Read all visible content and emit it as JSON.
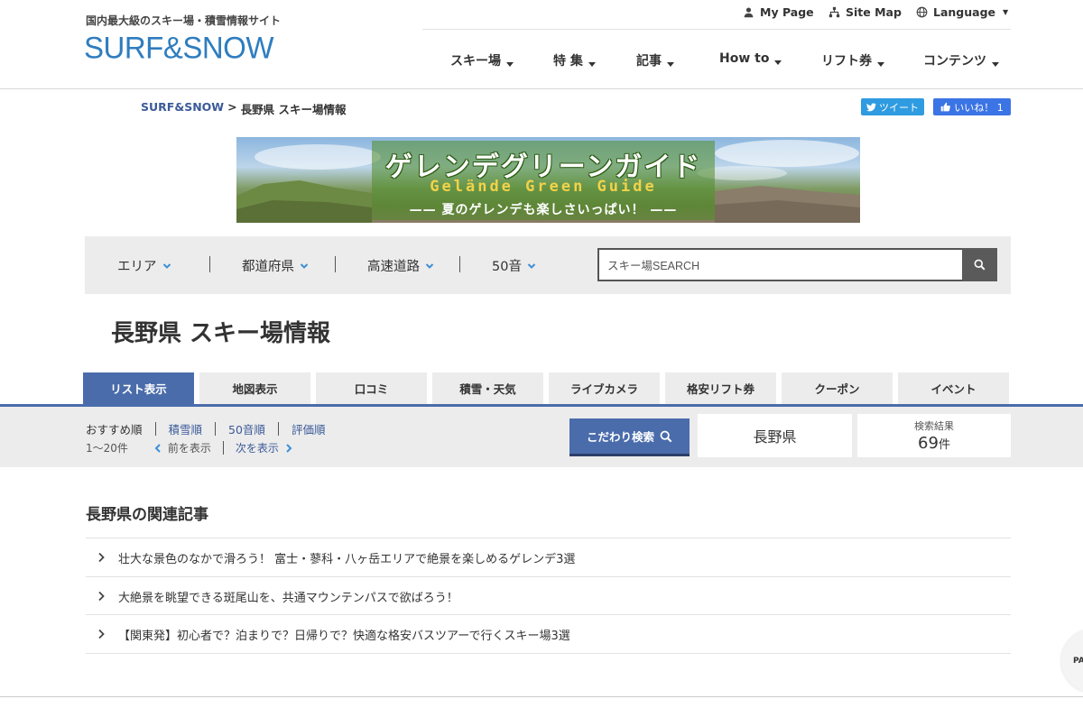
{
  "header": {
    "tagline": "国内最大級のスキー場・積雪情報サイト",
    "logo": "SURF&SNOW",
    "utility": {
      "my_page": "My Page",
      "site_map": "Site Map",
      "language": "Language"
    },
    "nav": [
      {
        "label": "スキー場"
      },
      {
        "label": "特 集"
      },
      {
        "label": "記事"
      },
      {
        "label": "How to"
      },
      {
        "label": "リフト券"
      },
      {
        "label": "コンテンツ"
      }
    ]
  },
  "breadcrumb": {
    "home": "SURF&SNOW",
    "separator": ">",
    "current": "長野県 スキー場情報"
  },
  "social": {
    "tweet": "ツイート",
    "like": "いいね！ 1"
  },
  "banner": {
    "title": "ゲレンデグリーンガイド",
    "subtitle": "Gelände Green Guide",
    "tagline": "—— 夏のゲレンデも楽しさいっぱい！ ——"
  },
  "filters": [
    {
      "label": "エリア"
    },
    {
      "label": "都道府県"
    },
    {
      "label": "高速道路"
    },
    {
      "label": "50音"
    }
  ],
  "search": {
    "placeholder": "スキー場SEARCH"
  },
  "page_title": "長野県 スキー場情報",
  "tabs": [
    {
      "label": "リスト表示",
      "active": true
    },
    {
      "label": "地図表示"
    },
    {
      "label": "口コミ"
    },
    {
      "label": "積雪・天気"
    },
    {
      "label": "ライブカメラ"
    },
    {
      "label": "格安リフト券"
    },
    {
      "label": "クーポン"
    },
    {
      "label": "イベント"
    }
  ],
  "sort": {
    "options": [
      "おすすめ順",
      "積雪順",
      "50音順",
      "評価順"
    ],
    "range": "1〜20件",
    "prev": "前を表示",
    "next": "次を表示"
  },
  "kodawari_search": "こだわり検索",
  "prefecture": "長野県",
  "result": {
    "label": "検索結果",
    "count": "69",
    "unit": "件"
  },
  "related": {
    "title": "長野県の関連記事",
    "articles": [
      "壮大な景色のなかで滑ろう！ 富士・蓼科・八ヶ岳エリアで絶景を楽しめるゲレンデ3選",
      "大絶景を眺望できる斑尾山を、共通マウンテンパスで欲ばろう！",
      "【関東発】初心者で？泊まりで？日帰りで？快適な格安バスツアーで行くスキー場3選"
    ]
  },
  "pagetop": "PA",
  "colors": {
    "accent": "#4a6cab",
    "logo": "#2f7dbf",
    "link": "#3c5a99",
    "tweet": "#2f9be0",
    "facebook": "#3b74e4"
  }
}
